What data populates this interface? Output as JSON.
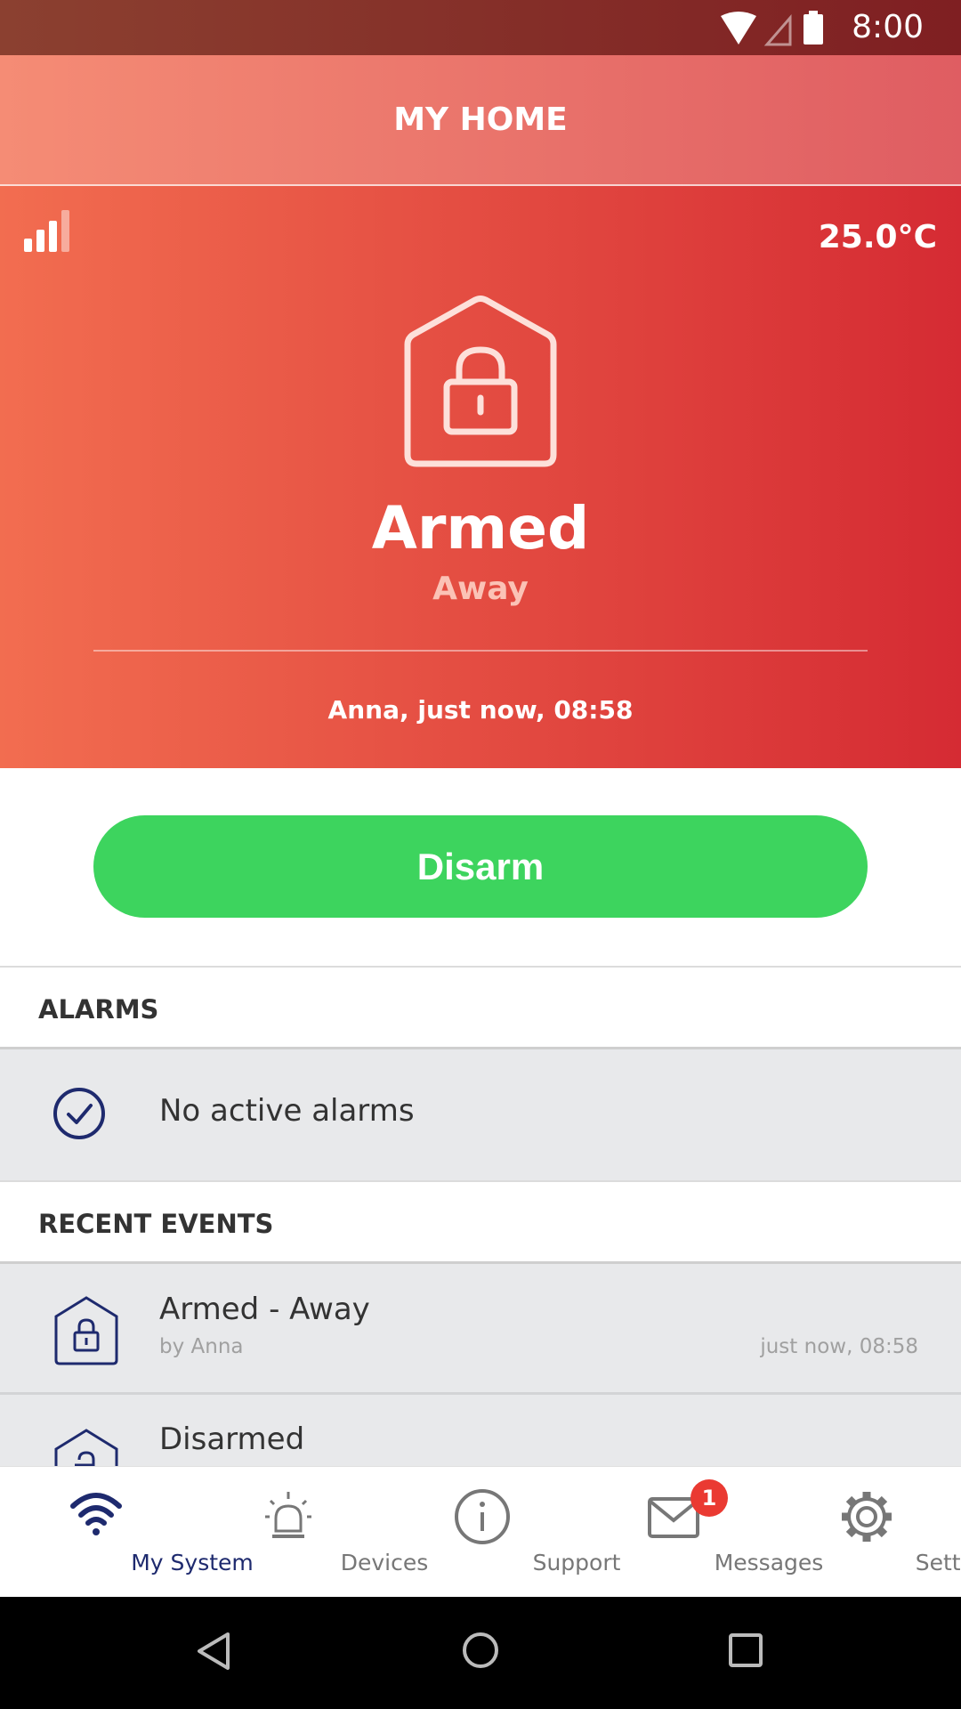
{
  "status_bar": {
    "time": "8:00",
    "icons": [
      "wifi-icon",
      "cell-signal-icon",
      "battery-icon"
    ]
  },
  "header": {
    "title": "MY HOME"
  },
  "hero": {
    "temperature": "25.0°C",
    "state": "Armed",
    "mode": "Away",
    "last_change": "Anna, just now, 08:58",
    "signal_strength": "3 of 4 bars"
  },
  "actions": {
    "disarm_label": "Disarm"
  },
  "alarms": {
    "heading": "ALARMS",
    "empty_text": "No active alarms"
  },
  "events": {
    "heading": "RECENT EVENTS",
    "items": [
      {
        "title": "Armed - Away",
        "by": "by Anna",
        "time": "just now, 08:58"
      },
      {
        "title": "Disarmed"
      }
    ]
  },
  "nav": {
    "items": [
      {
        "label": "My System",
        "active": true
      },
      {
        "label": "Devices"
      },
      {
        "label": "Support"
      },
      {
        "label": "Messages",
        "badge": "1"
      },
      {
        "label": "Settings"
      }
    ]
  },
  "colors": {
    "accent": "#1e2a6e",
    "disarm": "#3dd45e",
    "badge": "#ea3a32",
    "hero_start": "#f26d50",
    "hero_end": "#d52b33"
  }
}
